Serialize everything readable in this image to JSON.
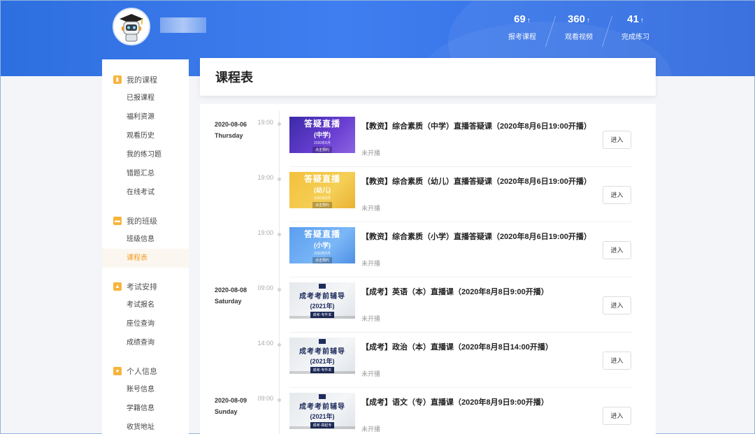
{
  "header": {
    "stats": [
      {
        "value": "69",
        "label": "报考课程"
      },
      {
        "value": "360",
        "label": "观看视频"
      },
      {
        "value": "41",
        "label": "完成练习"
      }
    ],
    "arrow": "↑"
  },
  "sidebar": {
    "groups": [
      {
        "title": "我的课程",
        "icon": "book-icon",
        "items": [
          "已报课程",
          "福利资源",
          "观看历史",
          "我的练习题",
          "错题汇总",
          "在线考试"
        ]
      },
      {
        "title": "我的班级",
        "icon": "class-icon",
        "items": [
          "班级信息",
          "课程表"
        ]
      },
      {
        "title": "考试安排",
        "icon": "exam-icon",
        "items": [
          "考试报名",
          "座位查询",
          "成绩查询"
        ]
      },
      {
        "title": "个人信息",
        "icon": "user-icon",
        "items": [
          "账号信息",
          "学籍信息",
          "收货地址"
        ]
      }
    ],
    "active_item": "课程表"
  },
  "main": {
    "title": "课程表",
    "enter_label": "进入",
    "rows": [
      {
        "date": "2020-08-06",
        "weekday": "Thursday",
        "time": "19:00",
        "thumb_style": "purple",
        "thumb_lines": [
          "答疑直播",
          "(中学)",
          "2020年8月",
          "点击预约"
        ],
        "title": "【教资】综合素质（中学）直播答疑课（2020年8月6日19:00开播）",
        "status": "未开播"
      },
      {
        "date": "",
        "weekday": "",
        "time": "19:00",
        "thumb_style": "yellow",
        "thumb_lines": [
          "答疑直播",
          "(幼儿)",
          "2020年8月",
          "点击预约"
        ],
        "title": "【教资】综合素质（幼儿）直播答疑课（2020年8月6日19:00开播）",
        "status": "未开播"
      },
      {
        "date": "",
        "weekday": "",
        "time": "19:00",
        "thumb_style": "sky",
        "thumb_lines": [
          "答疑直播",
          "(小学)",
          "2020年8月",
          "点击预约"
        ],
        "title": "【教资】综合素质（小学）直播答疑课（2020年8月6日19:00开播）",
        "status": "未开播"
      },
      {
        "date": "2020-08-08",
        "weekday": "Saturday",
        "time": "09:00",
        "thumb_style": "gray",
        "thumb_lines": [
          "成考考前辅导",
          "(2021年)",
          "",
          "成考·专升本"
        ],
        "title": "【成考】英语（本）直播课（2020年8月8日9:00开播）",
        "status": "未开播"
      },
      {
        "date": "",
        "weekday": "",
        "time": "14:00",
        "thumb_style": "gray",
        "thumb_lines": [
          "成考考前辅导",
          "(2021年)",
          "",
          "成考·专升本"
        ],
        "title": "【成考】政治（本）直播课（2020年8月8日14:00开播）",
        "status": "未开播"
      },
      {
        "date": "2020-08-09",
        "weekday": "Sunday",
        "time": "09:00",
        "thumb_style": "gray",
        "thumb_lines": [
          "成考考前辅导",
          "(2021年)",
          "",
          "成考·高起专"
        ],
        "title": "【成考】语文（专）直播课（2020年8月9日9:00开播）",
        "status": "未开播"
      }
    ]
  }
}
